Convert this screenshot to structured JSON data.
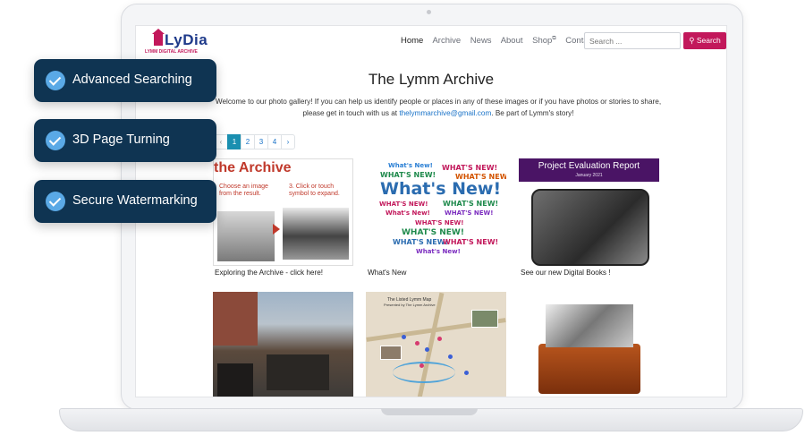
{
  "site": {
    "logo_text": "LyDia",
    "logo_sub": "LYMM DIGITAL ARCHIVE",
    "nav": [
      {
        "label": "Home"
      },
      {
        "label": "Archive"
      },
      {
        "label": "News"
      },
      {
        "label": "About"
      },
      {
        "label": "Shop"
      },
      {
        "label": "Contact"
      }
    ],
    "search_placeholder": "Search ...",
    "search_button": "Search"
  },
  "page": {
    "title": "The Lymm Archive",
    "intro": "Welcome to our photo gallery! If you can help us identify people or places in any of these images or if you have photos or stories to share, please get in touch with us at ",
    "email": "thelymmarchive@gmail.com",
    "intro_end": ". Be part of Lymm's story!",
    "pages": [
      "1",
      "2",
      "3",
      "4"
    ],
    "current_page": "1"
  },
  "cards": [
    {
      "caption": "Exploring the Archive - click here!",
      "heading": "the Archive",
      "text_a": "Choose an image from the result.",
      "text_b": "3. Click or touch symbol to expand."
    },
    {
      "caption": "What's New",
      "big": "What's New!",
      "small": "WHAT'S NEW!",
      "tiny": "What's New!"
    },
    {
      "caption": "See our new Digital Books !",
      "heading": "Project Evaluation Report",
      "date": "January 2021"
    },
    {
      "caption": ""
    },
    {
      "caption": "",
      "map_title": "The Listed Lymm Map",
      "map_sub": "Presented by The Lymm Archive"
    },
    {
      "caption": ""
    }
  ],
  "badges": [
    {
      "label": "Advanced Searching"
    },
    {
      "label": "3D Page Turning"
    },
    {
      "label": "Secure Watermarking"
    }
  ]
}
